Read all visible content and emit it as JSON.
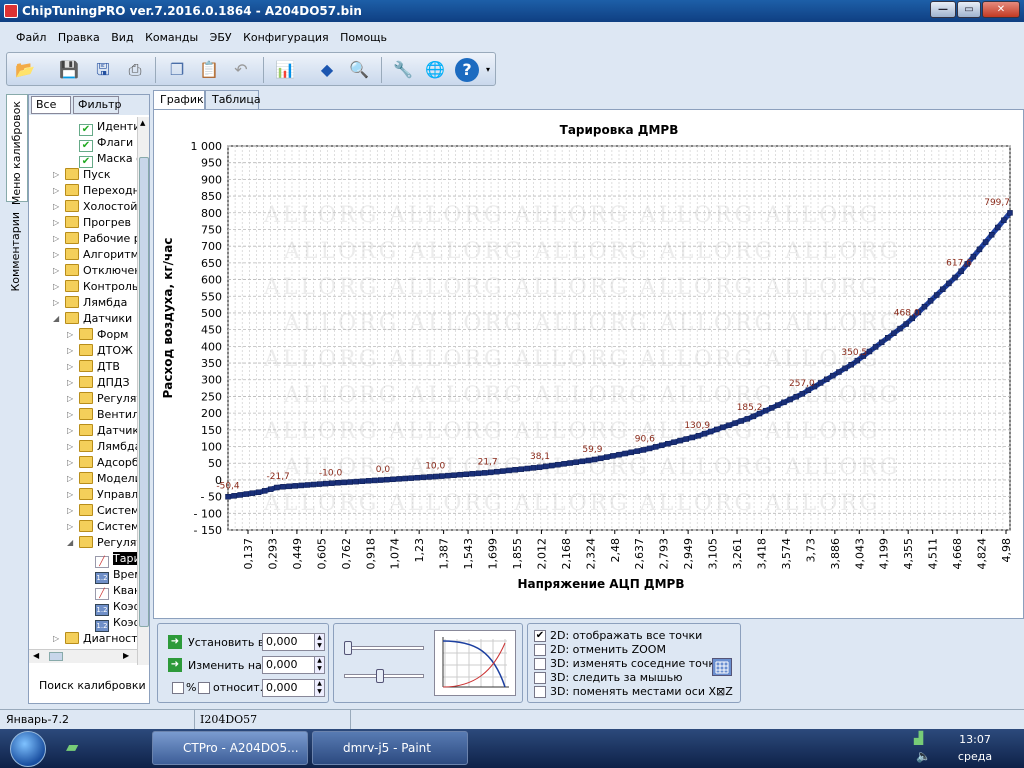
{
  "window": {
    "title": "ChipTuningPRO ver.7.2016.0.1864 - A204DO57.bin",
    "buttons": {
      "minimize": "—",
      "maximize": "▭",
      "close": "✕"
    }
  },
  "menu": [
    "Файл",
    "Правка",
    "Вид",
    "Команды",
    "ЭБУ",
    "Конфигурация",
    "Помощь"
  ],
  "toolbar": [
    "open-icon",
    "save-icon",
    "save-as-icon",
    "print-icon",
    "copy-icon",
    "paste-icon",
    "undo-icon",
    "chart-tools-icon",
    "info-icon",
    "zoom-icon",
    "tools-icon",
    "ecu-connect-icon",
    "help-icon"
  ],
  "left_tabs": {
    "calibrations": "Меню калибровок",
    "comments": "Комментарии"
  },
  "tree_tabs": {
    "all": "Все",
    "filter": "Фильтр"
  },
  "tree": [
    {
      "label": "Идентификация",
      "icon": "check",
      "level": 2
    },
    {
      "label": "Флаги исп.",
      "icon": "check",
      "level": 2
    },
    {
      "label": "Маска ошибок",
      "icon": "check",
      "level": 2
    },
    {
      "label": "Пуск",
      "icon": "folder",
      "level": 1
    },
    {
      "label": "Переходные режимы",
      "icon": "folder",
      "level": 1
    },
    {
      "label": "Холостой ход",
      "icon": "folder",
      "level": 1
    },
    {
      "label": "Прогрев",
      "icon": "folder",
      "level": 1
    },
    {
      "label": "Рабочие режимы",
      "icon": "folder",
      "level": 1
    },
    {
      "label": "Алгоритмы",
      "icon": "folder",
      "level": 1
    },
    {
      "label": "Отключения",
      "icon": "folder",
      "level": 1
    },
    {
      "label": "Контроль",
      "icon": "folder",
      "level": 1
    },
    {
      "label": "Лямбда",
      "icon": "folder",
      "level": 1
    },
    {
      "label": "Датчики",
      "icon": "folder",
      "level": 1,
      "open": true
    },
    {
      "label": "Форм",
      "icon": "folder",
      "level": 2
    },
    {
      "label": "ДТОЖ",
      "icon": "folder",
      "level": 2
    },
    {
      "label": "ДТВ",
      "icon": "folder",
      "level": 2
    },
    {
      "label": "ДПДЗ",
      "icon": "folder",
      "level": 2
    },
    {
      "label": "Регулятор",
      "icon": "folder",
      "level": 2
    },
    {
      "label": "Вентилятор",
      "icon": "folder",
      "level": 2
    },
    {
      "label": "Датчики",
      "icon": "folder",
      "level": 2
    },
    {
      "label": "Лямбда",
      "icon": "folder",
      "level": 2
    },
    {
      "label": "Адсорбер",
      "icon": "folder",
      "level": 2
    },
    {
      "label": "Модели",
      "icon": "folder",
      "level": 2
    },
    {
      "label": "Управление",
      "icon": "folder",
      "level": 2
    },
    {
      "label": "Система",
      "icon": "folder",
      "level": 2
    },
    {
      "label": "Система",
      "icon": "folder",
      "level": 2
    },
    {
      "label": "Регулятор",
      "icon": "folder",
      "level": 2,
      "open": true
    },
    {
      "label": "Тарировка ДМРВ",
      "icon": "curve",
      "level": 3,
      "selected": true
    },
    {
      "label": "Время",
      "icon": "num",
      "level": 3
    },
    {
      "label": "Квант",
      "icon": "curve",
      "level": 3
    },
    {
      "label": "Коэфф.",
      "icon": "num",
      "level": 3
    },
    {
      "label": "Коэфф.",
      "icon": "num",
      "level": 3
    },
    {
      "label": "Диагностика",
      "icon": "folder",
      "level": 1
    }
  ],
  "tree_search": "Поиск калибровки",
  "chart_tabs": {
    "graph": "График",
    "table": "Таблица"
  },
  "chart_data": {
    "type": "line",
    "title": "Тарировка ДМРВ",
    "xlabel": "Напряжение АЦП ДМРВ",
    "ylabel": "Расход воздуха, кг/час",
    "ylim": [
      -150,
      1000
    ],
    "y_ticks": [
      -150,
      -100,
      -50,
      0,
      50,
      100,
      150,
      200,
      250,
      300,
      350,
      400,
      450,
      500,
      550,
      600,
      650,
      700,
      750,
      800,
      850,
      900,
      950,
      1000
    ],
    "y_tick_labels": [
      "- 150",
      "- 100",
      "- 50",
      "0",
      "50",
      "100",
      "150",
      "200",
      "250",
      "300",
      "350",
      "400",
      "450",
      "500",
      "550",
      "600",
      "650",
      "700",
      "750",
      "800",
      "850",
      "900",
      "950",
      "1 000"
    ],
    "x_ticks": [
      "0,137",
      "0,293",
      "0,449",
      "0,605",
      "0,762",
      "0,918",
      "1,074",
      "1,23",
      "1,387",
      "1,543",
      "1,699",
      "1,855",
      "2,012",
      "2,168",
      "2,324",
      "2,48",
      "2,637",
      "2,793",
      "2,949",
      "3,105",
      "3,261",
      "3,418",
      "3,574",
      "3,73",
      "3,886",
      "4,043",
      "4,199",
      "4,355",
      "4,511",
      "4,668",
      "4,824",
      "4,98"
    ],
    "points": [
      {
        "x": 0.0,
        "y": -50.4
      },
      {
        "x": 0.293,
        "y": -36.0
      },
      {
        "x": 0.449,
        "y": -21.7
      },
      {
        "x": 0.918,
        "y": -10.0
      },
      {
        "x": 1.387,
        "y": 0.0
      },
      {
        "x": 1.855,
        "y": 10.0
      },
      {
        "x": 2.324,
        "y": 21.7
      },
      {
        "x": 2.793,
        "y": 38.1
      },
      {
        "x": 3.262,
        "y": 59.9
      },
      {
        "x": 3.731,
        "y": 90.6
      },
      {
        "x": 4.2,
        "y": 130.9
      },
      {
        "x": 4.669,
        "y": 185.2
      },
      {
        "x": 5.137,
        "y": 257.0
      },
      {
        "x": 5.606,
        "y": 350.5
      },
      {
        "x": 6.075,
        "y": 468.0
      },
      {
        "x": 6.544,
        "y": 617.6
      },
      {
        "x": 7.0,
        "y": 799.7
      }
    ],
    "point_labels": [
      "-50,4",
      "-21,7",
      "-10,0",
      "0,0",
      "10,0",
      "21,7",
      "38,1",
      "59,9",
      "90,6",
      "130,9",
      "185,2",
      "257,0",
      "350,5",
      "468,0",
      "617,6",
      "799,7"
    ],
    "label_points": [
      0,
      2,
      3,
      4,
      5,
      6,
      7,
      8,
      9,
      10,
      11,
      12,
      13,
      14,
      15,
      16
    ],
    "grid": true,
    "watermark": "ALLORG",
    "line_color": "#1f3f9e"
  },
  "controls": {
    "set_label": "Установить в",
    "set_value": "0,000",
    "change_label": "Изменить на",
    "change_value": "0,000",
    "percent_label": "%",
    "relative_label": "относит.",
    "relative_value": "0,000"
  },
  "options": [
    {
      "label": "2D: отображать все точки",
      "checked": true
    },
    {
      "label": "2D: отменить ZOOM",
      "checked": false
    },
    {
      "label": "3D: изменять соседние точки",
      "checked": false
    },
    {
      "label": "3D: следить за мышью",
      "checked": false
    },
    {
      "label": "3D: поменять местами оси X⊠Z",
      "checked": false
    }
  ],
  "status": {
    "left": "Январь-7.2",
    "right": "I204DO57"
  },
  "taskbar": {
    "tasks": [
      "CTPro - A204DO5...",
      "dmrv-j5 - Paint"
    ],
    "time": "13:07",
    "day": "среда"
  }
}
